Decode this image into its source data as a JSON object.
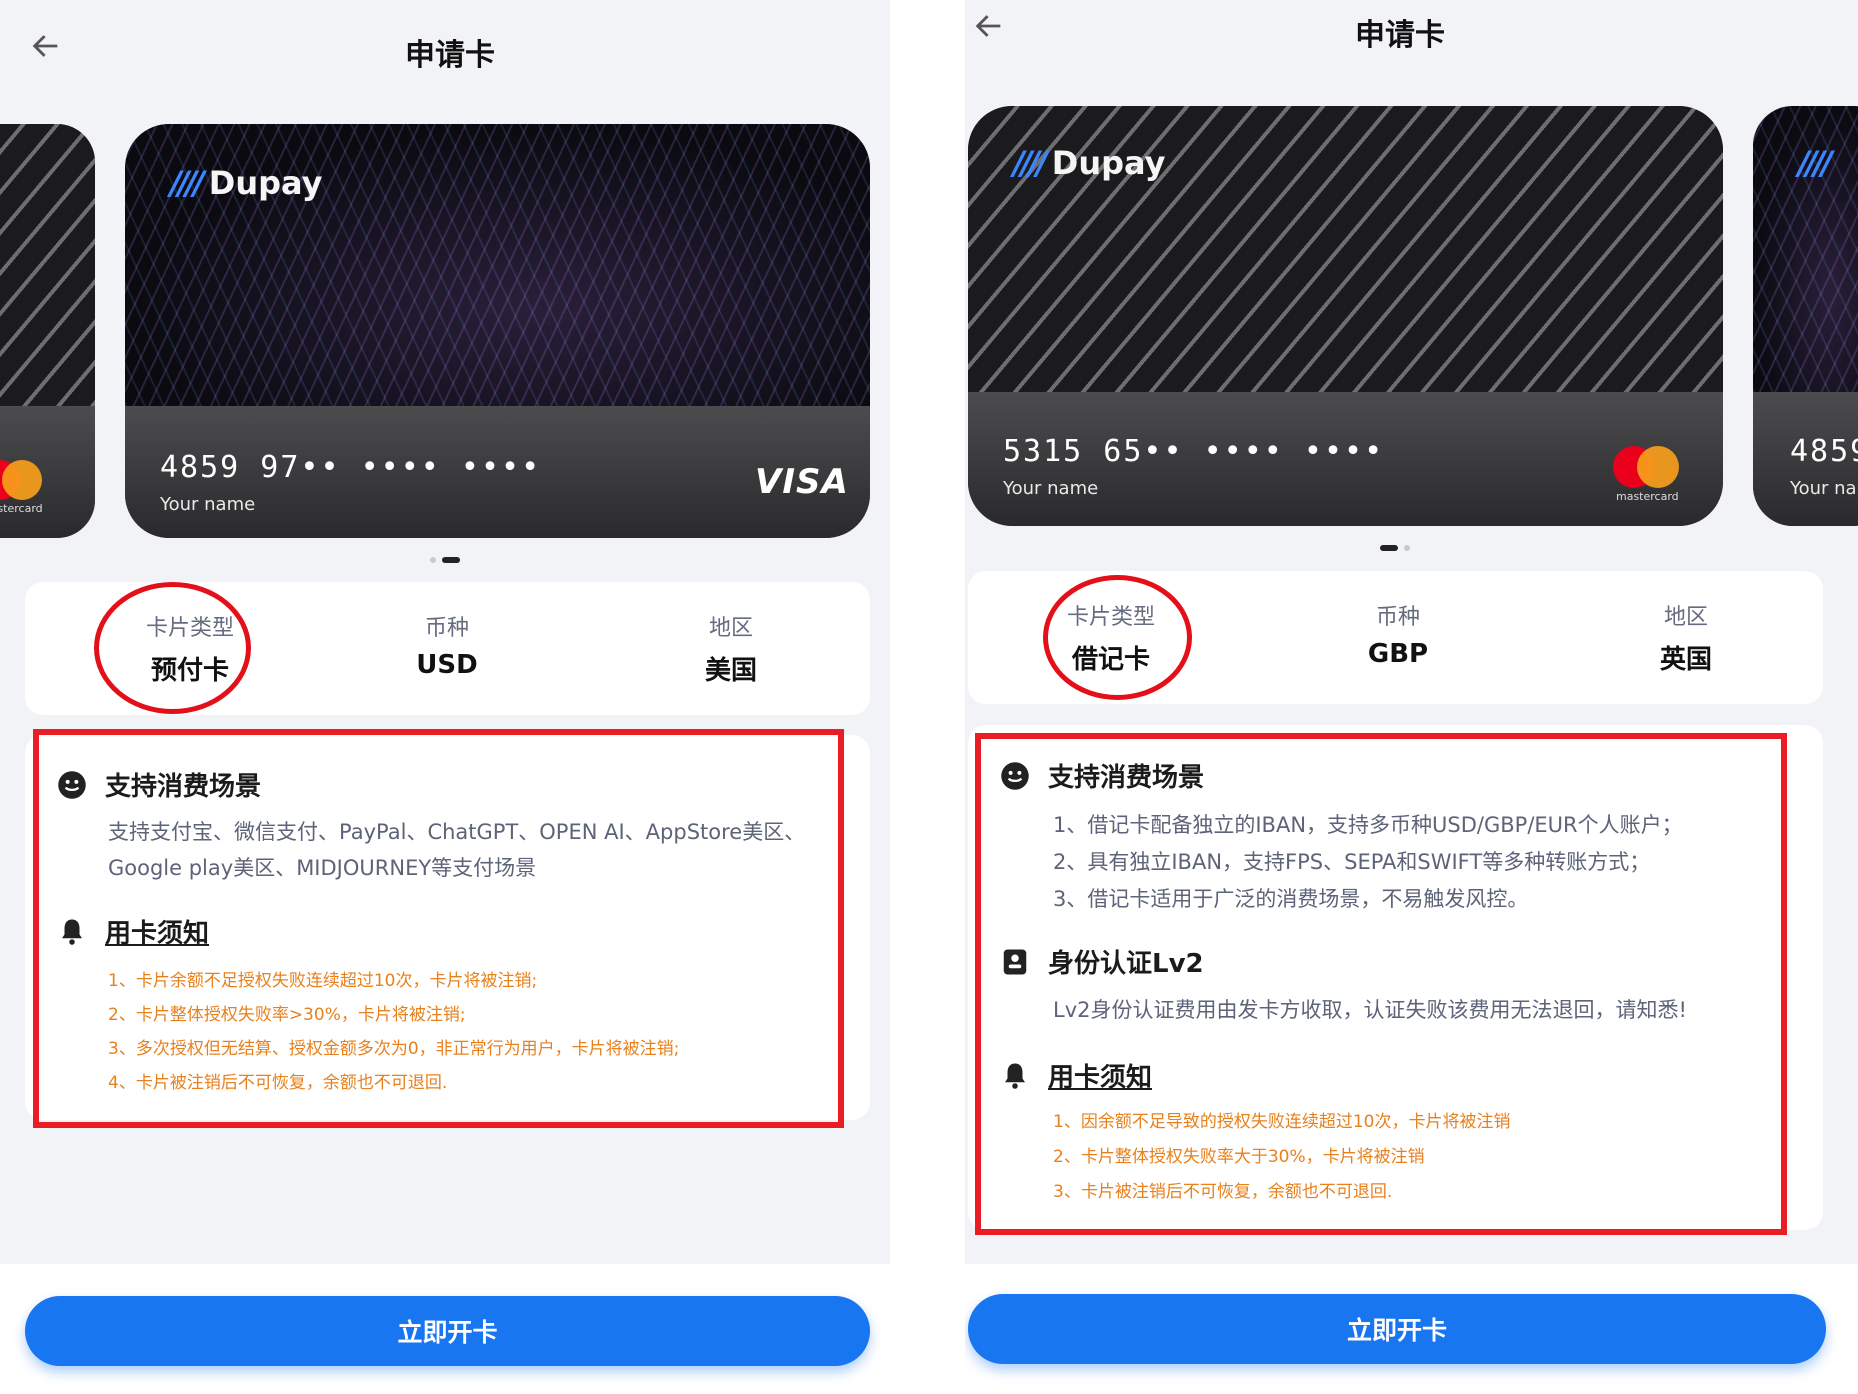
{
  "left_screen": {
    "title": "申请卡",
    "card": {
      "brand": "Dupay",
      "number": "4859 97•• •••• ••••",
      "name": "Your name",
      "network": "VISA"
    },
    "peek_card": {
      "network_text": "mastercard"
    },
    "info": [
      {
        "label": "卡片类型",
        "value": "预付卡"
      },
      {
        "label": "币种",
        "value": "USD"
      },
      {
        "label": "地区",
        "value": "美国"
      }
    ],
    "sections": {
      "scene_title": "支持消费场景",
      "scene_lines": [
        "支持支付宝、微信支付、PayPal、ChatGPT、OPEN AI、AppStore美区、",
        "Google play美区、MIDJOURNEY等支付场景"
      ],
      "notice_title": "用卡须知",
      "notice_lines": [
        "1、卡片余额不足授权失败连续超过10次，卡片将被注销;",
        "2、卡片整体授权失败率>30%，卡片将被注销;",
        "3、多次授权但无结算、授权金额多次为0，非正常行为用户，卡片将被注销;",
        "4、卡片被注销后不可恢复，余额也不可退回."
      ]
    },
    "button_label": "立即开卡"
  },
  "right_screen": {
    "title": "申请卡",
    "card": {
      "brand": "Dupay",
      "number": "5315 65•• •••• ••••",
      "name": "Your name",
      "network_text": "mastercard"
    },
    "peek_card": {
      "number": "4859",
      "name": "Your na"
    },
    "info": [
      {
        "label": "卡片类型",
        "value": "借记卡"
      },
      {
        "label": "币种",
        "value": "GBP"
      },
      {
        "label": "地区",
        "value": "英国"
      }
    ],
    "sections": {
      "scene_title": "支持消费场景",
      "scene_lines": [
        "1、借记卡配备独立的IBAN，支持多币种USD/GBP/EUR个人账户；",
        "2、具有独立IBAN，支持FPS、SEPA和SWIFT等多种转账方式；",
        "3、借记卡适用于广泛的消费场景，不易触发风控。"
      ],
      "kyc_title": "身份认证Lv2",
      "kyc_line": "Lv2身份认证费用由发卡方收取，认证失败该费用无法退回，请知悉!",
      "notice_title": "用卡须知",
      "notice_lines": [
        "1、因余额不足导致的授权失败连续超过10次，卡片将被注销",
        "2、卡片整体授权失败率大于30%，卡片将被注销",
        "3、卡片被注销后不可恢复，余额也不可退回."
      ]
    },
    "button_label": "立即开卡"
  },
  "colors": {
    "primary": "#1776f0",
    "warning": "#e8801c",
    "annotation_red": "#ec1c24"
  }
}
